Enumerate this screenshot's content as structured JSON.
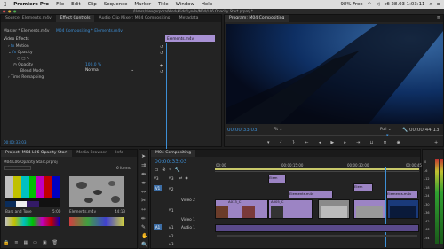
{
  "menubar": {
    "apple": "",
    "app": "Premiere Pro",
    "items": [
      "File",
      "Edit",
      "Clip",
      "Sequence",
      "Marker",
      "Title",
      "Window",
      "Help"
    ],
    "path": "/Users/alexgorpora/Work/Kids/Lynda/M04/L06 Opacity Start.prproj *",
    "battery": "98% Free",
    "clock": "сб 28.03  1:03:11"
  },
  "source_panel": {
    "tabs": [
      "Source: Elements.m4v",
      "Effect Controls",
      "Audio Clip Mixer: M04 Compositing",
      "Metadata"
    ],
    "active_tab": "Effect Controls",
    "master_label": "Master * Elements.m4v",
    "sequence_label": "M04 Compositing * Elements.m4v",
    "clip_label": "Elements.m4v",
    "section": "Video Effects",
    "effects": [
      {
        "name": "fx",
        "label": "Motion",
        "indent": "1"
      },
      {
        "name": "fx",
        "label": "Opacity",
        "indent": "1"
      },
      {
        "name": "",
        "label": "Opacity",
        "value": "100.0 %",
        "indent": "2"
      },
      {
        "name": "",
        "label": "Blend Mode",
        "value": "Normal",
        "indent": "2"
      },
      {
        "name": "",
        "label": "Time Remapping",
        "indent": "1"
      }
    ],
    "timecode": "00:00:33:03"
  },
  "program_panel": {
    "title": "Program: M04 Compositing",
    "timecode_left": "00:00:33:03",
    "fit": "Fit",
    "quality": "Full",
    "timecode_right": "00:00:44:13"
  },
  "project_panel": {
    "tabs": [
      "Project: M04 L06 Opacity Start",
      "Media Browser",
      "Info"
    ],
    "file": "M04 L06 Opacity Start.prproj",
    "count": "6 Items",
    "items": [
      {
        "name": "Bars and Tone",
        "dur": "5:00"
      },
      {
        "name": "Elements.m4v",
        "dur": "44:13"
      }
    ]
  },
  "timeline_panel": {
    "tab": "M04 Compositing",
    "timecode": "00:00:33:03",
    "ruler": [
      "00:00",
      "00:00:15:00",
      "00:00:30:00",
      "00:00:45:00"
    ],
    "tracks": {
      "video": [
        "V3",
        "V2",
        "V1"
      ],
      "audio": [
        "A1",
        "A2",
        "A3"
      ],
      "v_names": [
        "Video 2",
        "Video 1"
      ],
      "a_name": "Audio 1"
    },
    "clips": {
      "v3": [
        "Elem"
      ],
      "v2": [
        "Elements.m4v",
        "Elem",
        "Elements.m4v"
      ],
      "v1": [
        "A013_C",
        "A005_C"
      ]
    },
    "meter_labels": [
      "0",
      "-6",
      "-12",
      "-18",
      "-24",
      "-30",
      "-36",
      "-42",
      "-48",
      "-54"
    ]
  }
}
